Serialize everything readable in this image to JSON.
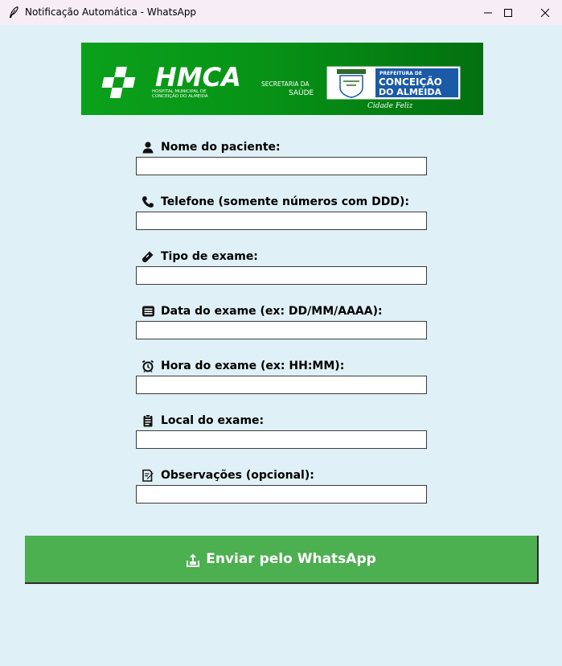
{
  "window": {
    "title": "Notificação Automática - WhatsApp"
  },
  "banner": {
    "hospital_name": "HMCA",
    "hospital_subtitle_line1": "HOSPITAL MUNICIPAL DE",
    "hospital_subtitle_line2": "CONCEIÇÃO DO ALMEIDA",
    "secretaria_line1": "SECRETARIA DA",
    "secretaria_line2": "SAÚDE",
    "prefeitura_line1": "PREFEITURA DE",
    "prefeitura_line2": "CONCEIÇÃO",
    "prefeitura_line3": "DO ALMEIDA",
    "slogan": "Cidade Feliz"
  },
  "form": {
    "fields": [
      {
        "label": "Nome do paciente:",
        "icon": "person-icon",
        "value": ""
      },
      {
        "label": "Telefone (somente números com DDD):",
        "icon": "phone-icon",
        "value": ""
      },
      {
        "label": "Tipo de exame:",
        "icon": "syringe-icon",
        "value": ""
      },
      {
        "label": "Data do exame (ex: DD/MM/AAAA):",
        "icon": "calendar-list-icon",
        "value": ""
      },
      {
        "label": "Hora do exame (ex: HH:MM):",
        "icon": "alarm-clock-icon",
        "value": ""
      },
      {
        "label": "Local do exame:",
        "icon": "clipboard-icon",
        "value": ""
      },
      {
        "label": "Observações (opcional):",
        "icon": "note-edit-icon",
        "value": ""
      }
    ]
  },
  "send_button": {
    "label": "Enviar pelo WhatsApp",
    "icon": "send-outbox-icon",
    "color": "#4caf50"
  },
  "colors": {
    "background": "#dff0f6",
    "titlebar": "#f6edf6",
    "banner_green": "#079316",
    "prefeitura_blue": "#1a5aa6"
  }
}
